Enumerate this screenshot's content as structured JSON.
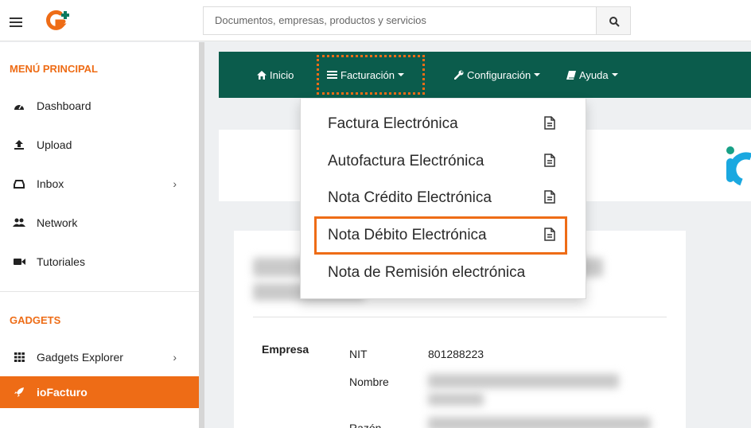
{
  "header": {
    "search_placeholder": "Documentos, empresas, productos y servicios"
  },
  "sidebar": {
    "main_title": "MENÚ PRINCIPAL",
    "items": [
      {
        "label": "Dashboard",
        "icon": "dashboard-icon"
      },
      {
        "label": "Upload",
        "icon": "upload-icon"
      },
      {
        "label": "Inbox",
        "icon": "inbox-icon"
      },
      {
        "label": "Network",
        "icon": "users-icon"
      },
      {
        "label": "Tutoriales",
        "icon": "video-icon"
      }
    ],
    "gadgets_title": "GADGETS",
    "gadget_items": [
      {
        "label": "Gadgets Explorer",
        "icon": "grid-icon"
      },
      {
        "label": "ioFacturo",
        "icon": "rocket-icon"
      }
    ]
  },
  "navbar": {
    "items": [
      {
        "label": "Inicio",
        "icon": "home-icon"
      },
      {
        "label": "Facturación",
        "icon": "list-icon"
      },
      {
        "label": "Configuración",
        "icon": "wrench-icon"
      },
      {
        "label": "Ayuda",
        "icon": "book-icon"
      }
    ]
  },
  "dropdown": {
    "items": [
      {
        "label": "Factura Electrónica"
      },
      {
        "label": "Autofactura Electrónica"
      },
      {
        "label": "Nota Crédito Electrónica"
      },
      {
        "label": "Nota Débito Electrónica"
      },
      {
        "label": "Nota de Remisión electrónica"
      }
    ]
  },
  "card": {
    "empresa_label": "Empresa",
    "nit_label": "NIT",
    "nit_value": "801288223",
    "nombre_label": "Nombre",
    "razon_label": "Razón"
  },
  "colors": {
    "accent": "#ee6c16",
    "navbar": "#0b5c4c"
  }
}
